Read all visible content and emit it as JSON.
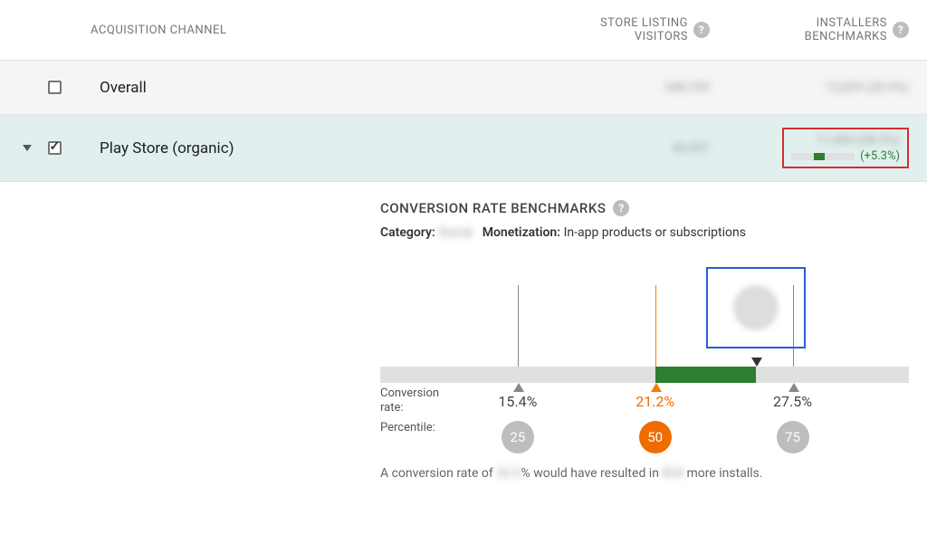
{
  "columns": {
    "channel": "ACQUISITION CHANNEL",
    "visitors_line1": "STORE LISTING",
    "visitors_line2": "VISITORS",
    "installers_line1": "INSTALLERS",
    "installers_line2": "BENCHMARKS"
  },
  "rows": [
    {
      "label": "Overall",
      "checked": false,
      "expanded": false,
      "visitors_blur": "348,769",
      "installers_blur": "72,829 (20.0%)"
    },
    {
      "label": "Play Store (organic)",
      "checked": true,
      "expanded": true,
      "visitors_blur": "40,397",
      "installers_blur": "11,454 (28.3%)",
      "delta": "(+5.3%)"
    }
  ],
  "detail": {
    "title": "CONVERSION RATE BENCHMARKS",
    "category_label": "Category:",
    "category_value_blur": "Social",
    "monetization_label": "Monetization:",
    "monetization_value": "In-app products or subscriptions",
    "conversion_rate_label": "Conversion rate:",
    "percentile_label": "Percentile:",
    "markers": {
      "p25": {
        "rate": "15.4%",
        "percentile": "25",
        "pos_pct": 26
      },
      "p50": {
        "rate": "21.2%",
        "percentile": "50",
        "pos_pct": 52
      },
      "p75": {
        "rate": "27.5%",
        "percentile": "75",
        "pos_pct": 78
      }
    },
    "green_bar": {
      "left_pct": 52,
      "right_pct": 71
    },
    "you_marker_pos_pct": 71,
    "footer_prefix": "A conversion rate of ",
    "footer_blur1": "32.5",
    "footer_mid": "% would have resulted in ",
    "footer_blur2": "824",
    "footer_suffix": " more installs."
  },
  "chart_data": {
    "type": "bar",
    "title": "Conversion Rate Benchmarks",
    "xlabel": "Conversion rate",
    "ylabel": "",
    "series": [
      {
        "name": "Percentile",
        "values": [
          25,
          50,
          75
        ]
      }
    ],
    "categories": [
      "15.4%",
      "21.2%",
      "27.5%"
    ],
    "highlight_range": [
      21.2,
      27.5
    ],
    "ylim": [
      0,
      100
    ]
  }
}
